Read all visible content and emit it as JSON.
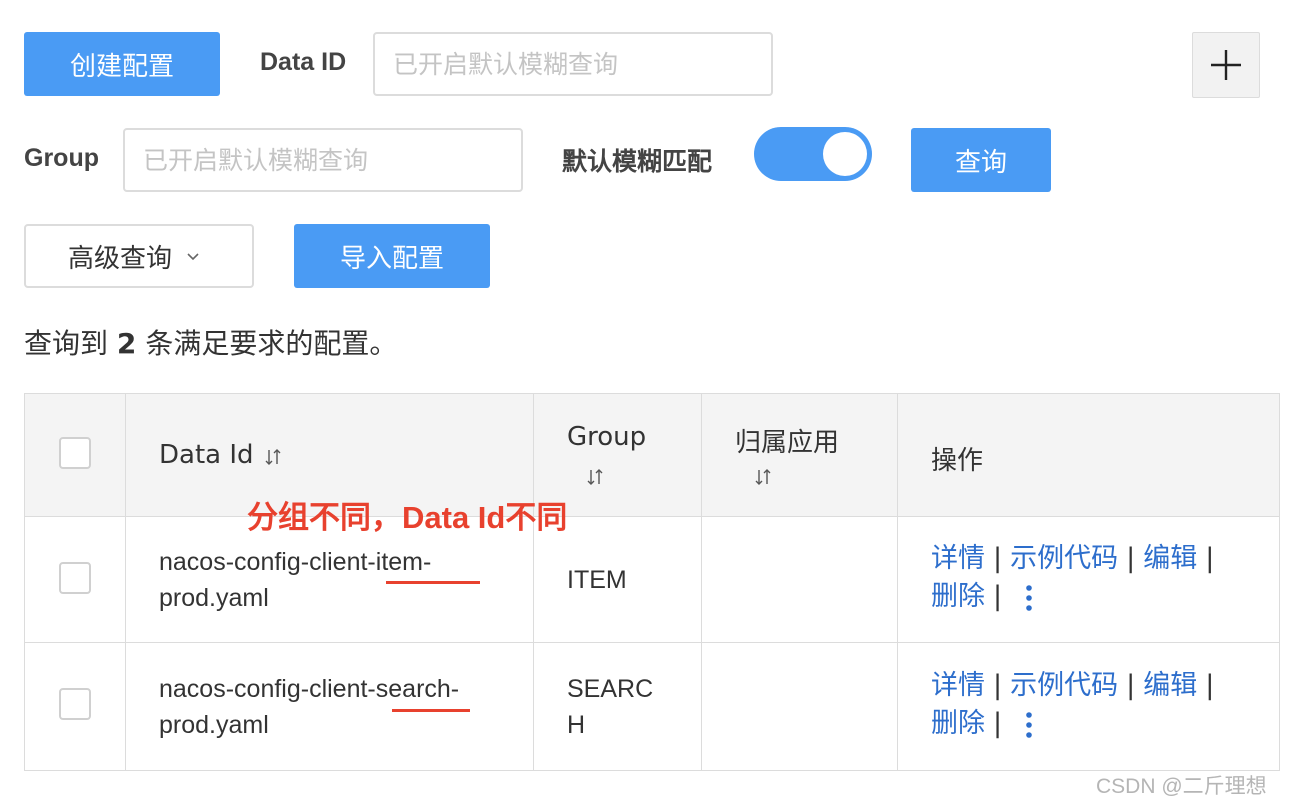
{
  "toolbar": {
    "create_label": "创建配置",
    "data_id_label": "Data ID",
    "data_id_placeholder": "已开启默认模糊查询",
    "group_label": "Group",
    "group_placeholder": "已开启默认模糊查询",
    "fuzzy_label": "默认模糊匹配",
    "fuzzy_on": true,
    "search_label": "查询",
    "advanced_label": "高级查询",
    "import_label": "导入配置"
  },
  "summary": {
    "prefix": "查询到",
    "count": "2",
    "suffix": "条满足要求的配置。"
  },
  "table": {
    "headers": {
      "data_id": "Data Id",
      "group": "Group",
      "app": "归属应用",
      "ops": "操作"
    },
    "rows": [
      {
        "data_id": "nacos-config-client-item-prod.yaml",
        "group": "ITEM",
        "app": ""
      },
      {
        "data_id": "nacos-config-client-search-prod.yaml",
        "group": "SEARCH",
        "app": ""
      }
    ],
    "ops": {
      "detail": "详情",
      "sample": "示例代码",
      "edit": "编辑",
      "delete": "删除",
      "separator": "|"
    }
  },
  "annotation": "分组不同，Data Id不同",
  "watermark": "CSDN @二斤理想",
  "colors": {
    "primary": "#4a9bf4",
    "link": "#2d6ecc",
    "annotation": "#e8412e"
  },
  "icons": {
    "plus": "plus-icon",
    "sort": "sort-icon",
    "chevron": "chevron-down-icon",
    "more": "more-vertical-icon"
  }
}
